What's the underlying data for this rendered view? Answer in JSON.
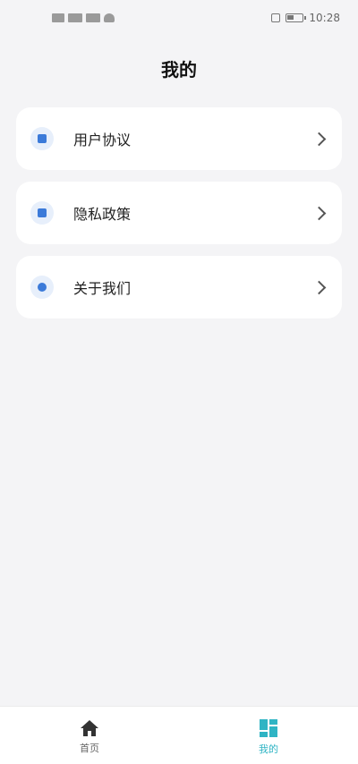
{
  "status_bar": {
    "time": "10:28"
  },
  "header": {
    "title": "我的"
  },
  "menu": {
    "items": [
      {
        "label": "用户协议",
        "icon": "document-icon"
      },
      {
        "label": "隐私政策",
        "icon": "privacy-icon"
      },
      {
        "label": "关于我们",
        "icon": "info-icon"
      }
    ]
  },
  "bottom_nav": {
    "items": [
      {
        "label": "首页",
        "icon": "home-icon",
        "active": false
      },
      {
        "label": "我的",
        "icon": "dashboard-icon",
        "active": true
      }
    ]
  },
  "colors": {
    "accent": "#2fb4c4",
    "icon_blue": "#3b7ad9",
    "background": "#f4f4f6",
    "card": "#ffffff"
  }
}
